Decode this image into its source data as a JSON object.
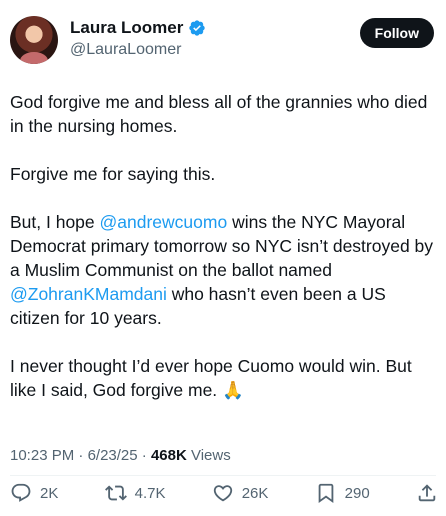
{
  "author": {
    "display_name": "Laura Loomer",
    "handle": "@LauraLoomer",
    "avatar_icon": "profile-photo",
    "verified_icon": "blue-verified-badge",
    "verified_color": "#1d9bf0"
  },
  "follow_button": {
    "label": "Follow"
  },
  "tweet": {
    "p1": "God forgive me and bless all of the grannies who died in the nursing homes.",
    "p2": "Forgive me for saying this.",
    "p3_a": "But, I hope ",
    "p3_mention1": "@andrewcuomo",
    "p3_b": " wins the NYC Mayoral Democrat primary tomorrow so NYC isn’t destroyed by a Muslim Communist on the ballot named ",
    "p3_mention2": "@ZohranKMamdani",
    "p3_c": " who hasn’t even been a US citizen for 10 years.",
    "p4": "I never thought I’d ever hope Cuomo would win. But like I said, God forgive me. ",
    "p4_emoji": "🙏",
    "mention_color": "#1d9bf0"
  },
  "meta": {
    "time": "10:23 PM",
    "sep1": " · ",
    "date": "6/23/25",
    "sep2": " · ",
    "views_count": "468K",
    "views_label": " Views"
  },
  "actions": {
    "replies": "2K",
    "reposts": "4.7K",
    "likes": "26K",
    "bookmarks": "290",
    "reply_icon": "reply-bubble-icon",
    "repost_icon": "repost-arrows-icon",
    "like_icon": "heart-icon",
    "bookmark_icon": "bookmark-icon",
    "share_icon": "share-upload-icon"
  }
}
